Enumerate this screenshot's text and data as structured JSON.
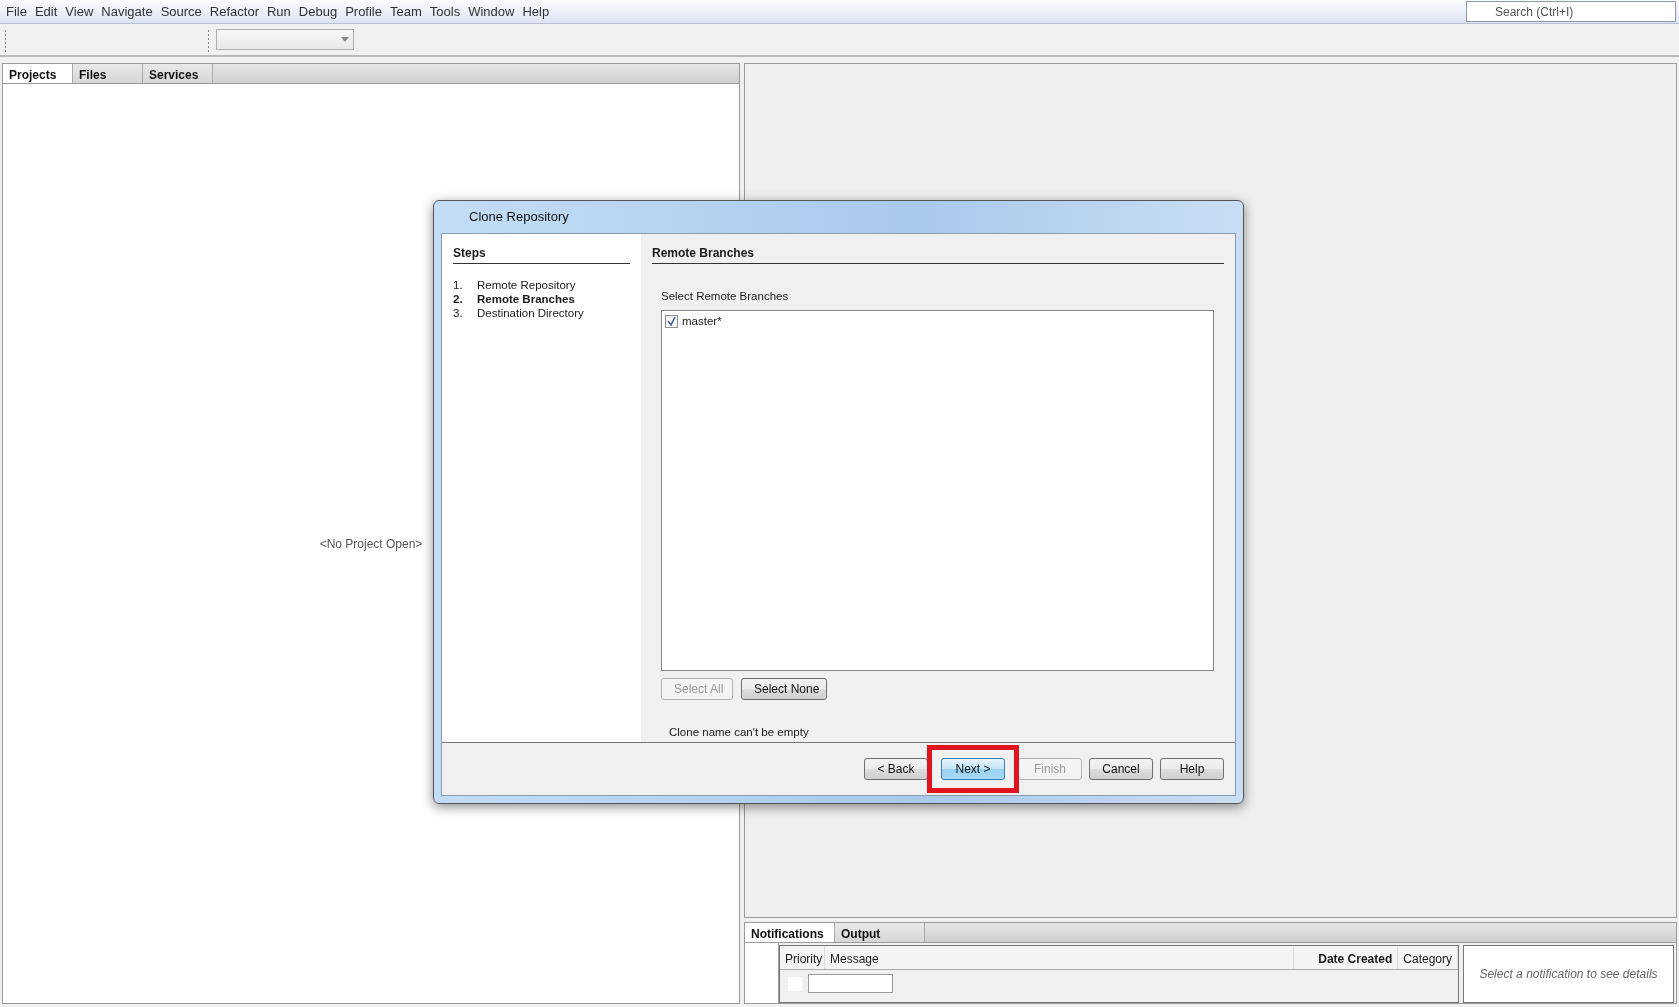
{
  "menu": [
    "File",
    "Edit",
    "View",
    "Navigate",
    "Source",
    "Refactor",
    "Run",
    "Debug",
    "Profile",
    "Team",
    "Tools",
    "Window",
    "Help"
  ],
  "search": {
    "placeholder": "Search (Ctrl+I)"
  },
  "project_tabs": [
    {
      "label": "Projects",
      "selected": true
    },
    {
      "label": "Files",
      "selected": false
    },
    {
      "label": "Services",
      "selected": false
    }
  ],
  "project_panel": {
    "empty_text": "<No Project Open>"
  },
  "dialog": {
    "title": "Clone Repository",
    "steps_heading": "Steps",
    "steps": [
      {
        "number": "1.",
        "label": "Remote Repository",
        "selected": false
      },
      {
        "number": "2.",
        "label": "Remote Branches",
        "selected": true
      },
      {
        "number": "3.",
        "label": "Destination Directory",
        "selected": false
      }
    ],
    "panel_title": "Remote Branches",
    "list_label": "Select Remote Branches",
    "branches": [
      {
        "label": "master*",
        "checked": true
      }
    ],
    "list_buttons": [
      {
        "label": "Select All",
        "disabled": true
      },
      {
        "label": "Select None",
        "disabled": false
      }
    ],
    "message": "Clone name can't be empty",
    "footer_buttons": [
      {
        "label": "< Back",
        "disabled": false,
        "highlighted": false
      },
      {
        "label": "Next >",
        "disabled": false,
        "highlighted": true
      },
      {
        "label": "Finish",
        "disabled": true,
        "highlighted": false
      },
      {
        "label": "Cancel",
        "disabled": false,
        "highlighted": false
      },
      {
        "label": "Help",
        "disabled": false,
        "highlighted": false
      }
    ]
  },
  "output_tabs": [
    {
      "label": "Notifications",
      "selected": true
    },
    {
      "label": "Output",
      "selected": false
    }
  ],
  "notifications": {
    "columns": [
      {
        "label": "Priority",
        "sorted": false
      },
      {
        "label": "Message",
        "sorted": false
      },
      {
        "label": "Date Created",
        "sorted": true
      },
      {
        "label": "Category",
        "sorted": false
      }
    ],
    "details_placeholder": "Select a notification to see details"
  }
}
